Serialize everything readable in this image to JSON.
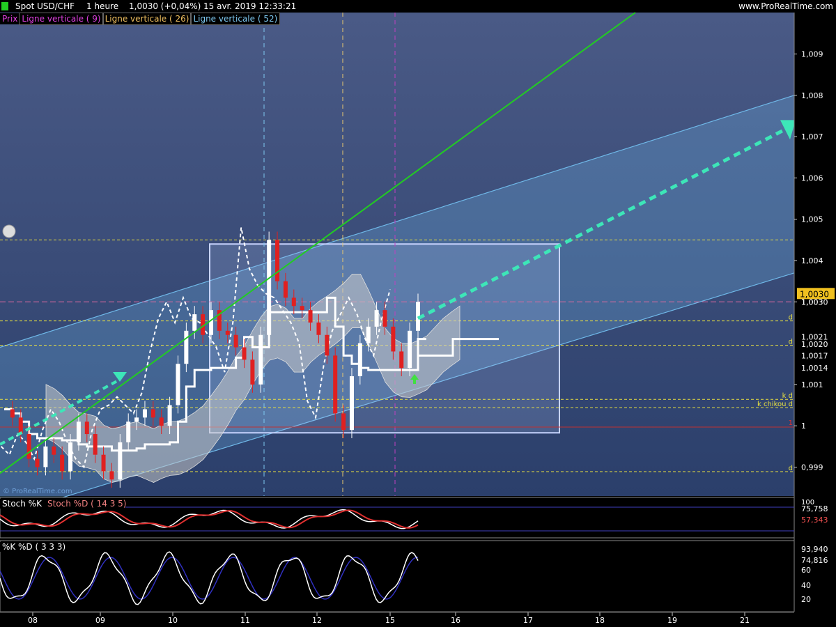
{
  "header": {
    "instrument": "Spot USD/CHF",
    "timeframe": "1 heure",
    "last_price": "1,0030 (+0,04%)",
    "datetime": "15 avr. 2019 12:33:21",
    "site": "www.ProRealTime.com"
  },
  "legend": {
    "prix": "Prix",
    "lv9": "Ligne verticale ( 9)",
    "lv26": "Ligne verticale ( 26)",
    "lv52": "Ligne verticale ( 52)"
  },
  "colors": {
    "bg_main": "#2b3f6b",
    "bg_top": "#4a5a86",
    "channel": "#6fb8e8",
    "green_line": "#22cc22",
    "arrow": "#3de6b8",
    "ref_yellow": "#e8e040",
    "ref_pink": "#e06aa0",
    "up_candle": "#ffffff",
    "down_candle": "#e02020",
    "cloud": "#c8c8c8",
    "box": "#c8d4ff",
    "stoch_bg": "#000000",
    "vline_blue": "#7ec8f0",
    "vline_orange": "#e8c870",
    "vline_magenta": "#c040c0"
  },
  "price_axis": {
    "ticks": [
      "1,009",
      "1,008",
      "1,007",
      "1,006",
      "1,005",
      "1,004",
      "1,003",
      "1,001",
      "1",
      "0,999"
    ],
    "tick_values": [
      1.009,
      1.008,
      1.007,
      1.006,
      1.005,
      1.004,
      1.003,
      1.001,
      1.0,
      0.999
    ],
    "current_label": "1,0030",
    "level_labels": [
      {
        "text": "1,0030",
        "value": 1.003
      },
      {
        "text": "1,0021",
        "value": 1.00215
      },
      {
        "text": "1,0020",
        "value": 1.00198
      },
      {
        "text": "1,0017",
        "value": 1.0017
      },
      {
        "text": "1,0014",
        "value": 1.0014
      }
    ],
    "ref_tags": [
      {
        "text": "d",
        "value": 1.00254
      },
      {
        "text": "d",
        "value": 1.00195
      },
      {
        "text": "k d",
        "value": 1.00064
      },
      {
        "text": "k chikou d",
        "value": 1.00044
      },
      {
        "text": "d",
        "value": 0.99889
      }
    ],
    "red_tag": "1",
    "ylim": [
      0.9983,
      1.0097
    ]
  },
  "time_axis": {
    "labels": [
      "08",
      "09",
      "10",
      "11",
      "12",
      "15",
      "16",
      "17",
      "18",
      "19",
      "21"
    ]
  },
  "ref_levels": {
    "yellow": [
      1.0045,
      1.00254,
      1.00195,
      1.00064,
      1.00044,
      0.99889
    ],
    "pink": [
      1.003
    ],
    "red": [
      0.99997
    ]
  },
  "watermark": "© ProRealTime.com",
  "stoch1": {
    "label_k": "Stoch %K",
    "label_d": "Stoch %D ( 14 3 5)",
    "value_k": "75,758",
    "value_d": "57,343",
    "top_tick": "100"
  },
  "stoch2": {
    "label_k": "%K",
    "label_d": "%D ( 3 3 3)",
    "value_k": "93,940",
    "value_d": "74,816",
    "ticks": [
      "60",
      "40",
      "20"
    ]
  },
  "chart_data": {
    "type": "line",
    "title": "Spot USD/CHF",
    "xlabel": "",
    "ylabel": "",
    "ylim": [
      0.9983,
      1.0097
    ],
    "series": [
      {
        "name": "Prix",
        "values": [
          1.0004,
          1.0002,
          0.9998,
          0.9992,
          0.999,
          0.9995,
          0.9993,
          0.9989,
          0.9996,
          1.0001,
          0.9998,
          0.9993,
          0.9989,
          0.9987,
          0.9996,
          1.0001,
          1.0002,
          1.0004,
          1.0002,
          1.0,
          1.0005,
          1.0015,
          1.0023,
          1.0027,
          1.0022,
          1.0028,
          1.0023,
          1.0022,
          1.0019,
          1.0016,
          1.001,
          1.0022,
          1.0045,
          1.0035,
          1.0031,
          1.0029,
          1.0028,
          1.0025,
          1.0022,
          1.0017,
          1.0003,
          0.9999,
          1.0012,
          1.002,
          1.0024,
          1.0028,
          1.0024,
          1.0018,
          1.0014,
          1.0023,
          1.003
        ]
      }
    ]
  }
}
